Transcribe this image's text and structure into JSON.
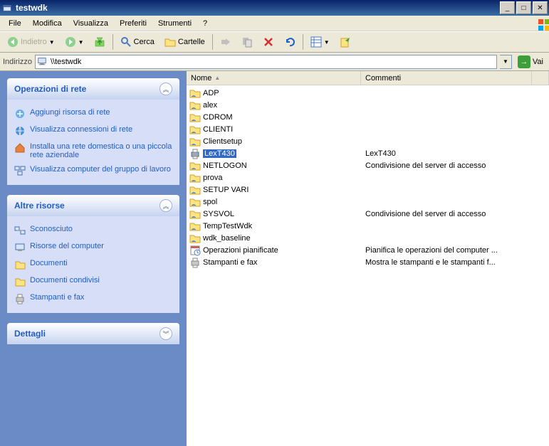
{
  "window": {
    "title": "testwdk"
  },
  "menu": {
    "file": "File",
    "modifica": "Modifica",
    "visualizza": "Visualizza",
    "preferiti": "Preferiti",
    "strumenti": "Strumenti",
    "help": "?"
  },
  "toolbar": {
    "back": "Indietro",
    "search": "Cerca",
    "folders": "Cartelle"
  },
  "address": {
    "label": "Indirizzo",
    "value": "\\\\testwdk",
    "go": "Vai"
  },
  "panels": {
    "network": {
      "title": "Operazioni di rete",
      "items": [
        "Aggiungi risorsa di rete",
        "Visualizza connessioni di rete",
        "Installa una rete domestica o una piccola rete aziendale",
        "Visualizza computer del gruppo di lavoro"
      ]
    },
    "other": {
      "title": "Altre risorse",
      "items": [
        "Sconosciuto",
        "Risorse del computer",
        "Documenti",
        "Documenti condivisi",
        "Stampanti e fax"
      ]
    },
    "details": {
      "title": "Dettagli"
    }
  },
  "columns": {
    "name": "Nome",
    "comments": "Commenti"
  },
  "files": [
    {
      "name": "ADP",
      "comment": "",
      "type": "share",
      "sel": false
    },
    {
      "name": "alex",
      "comment": "",
      "type": "share",
      "sel": false
    },
    {
      "name": "CDROM",
      "comment": "",
      "type": "share",
      "sel": false
    },
    {
      "name": "CLIENTI",
      "comment": "",
      "type": "share",
      "sel": false
    },
    {
      "name": "Clientsetup",
      "comment": "",
      "type": "share",
      "sel": false
    },
    {
      "name": "LexT430",
      "comment": "LexT430",
      "type": "printer",
      "sel": true
    },
    {
      "name": "NETLOGON",
      "comment": "Condivisione del server di accesso",
      "type": "share",
      "sel": false
    },
    {
      "name": "prova",
      "comment": "",
      "type": "share",
      "sel": false
    },
    {
      "name": "SETUP VARI",
      "comment": "",
      "type": "share",
      "sel": false
    },
    {
      "name": "spol",
      "comment": "",
      "type": "share",
      "sel": false
    },
    {
      "name": "SYSVOL",
      "comment": "Condivisione del server di accesso",
      "type": "share",
      "sel": false
    },
    {
      "name": "TempTestWdk",
      "comment": "",
      "type": "share",
      "sel": false
    },
    {
      "name": "wdk_baseline",
      "comment": "",
      "type": "share",
      "sel": false
    },
    {
      "name": "Operazioni pianificate",
      "comment": "Pianifica le operazioni del computer ...",
      "type": "tasks",
      "sel": false
    },
    {
      "name": "Stampanti e fax",
      "comment": "Mostra le stampanti e le stampanti f...",
      "type": "printers",
      "sel": false
    }
  ]
}
